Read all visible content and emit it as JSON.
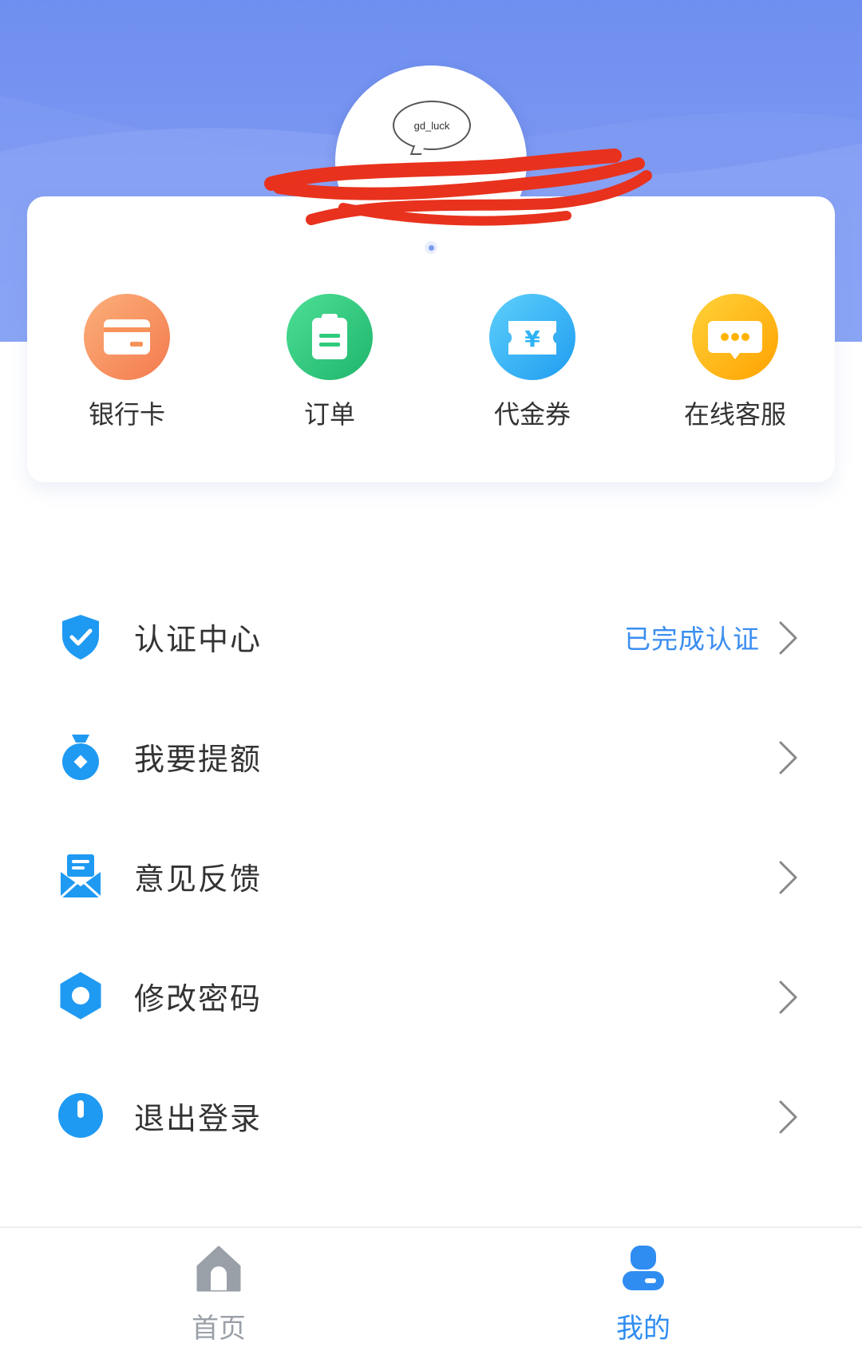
{
  "profile": {
    "avatar_text": "gd_luck"
  },
  "quick_actions": [
    {
      "label": "银行卡",
      "icon": "bank-card-icon",
      "color": "#f7935a"
    },
    {
      "label": "订单",
      "icon": "order-clipboard-icon",
      "color": "#2fca7c"
    },
    {
      "label": "代金券",
      "icon": "voucher-ticket-icon",
      "color": "#2fb3f5"
    },
    {
      "label": "在线客服",
      "icon": "chat-bubble-icon",
      "color": "#ffb300"
    }
  ],
  "menu": [
    {
      "label": "认证中心",
      "status": "已完成认证",
      "icon": "shield-check-icon"
    },
    {
      "label": "我要提额",
      "status": "",
      "icon": "money-bag-icon"
    },
    {
      "label": "意见反馈",
      "status": "",
      "icon": "envelope-icon"
    },
    {
      "label": "修改密码",
      "status": "",
      "icon": "hexagon-icon"
    },
    {
      "label": "退出登录",
      "status": "",
      "icon": "power-icon"
    }
  ],
  "tabbar": {
    "home_label": "首页",
    "mine_label": "我的",
    "active": "mine"
  },
  "colors": {
    "header": "#6f8ff0",
    "accent": "#2f8df2",
    "status_text": "#3b8ef0",
    "icon_blue": "#1f9af2"
  }
}
